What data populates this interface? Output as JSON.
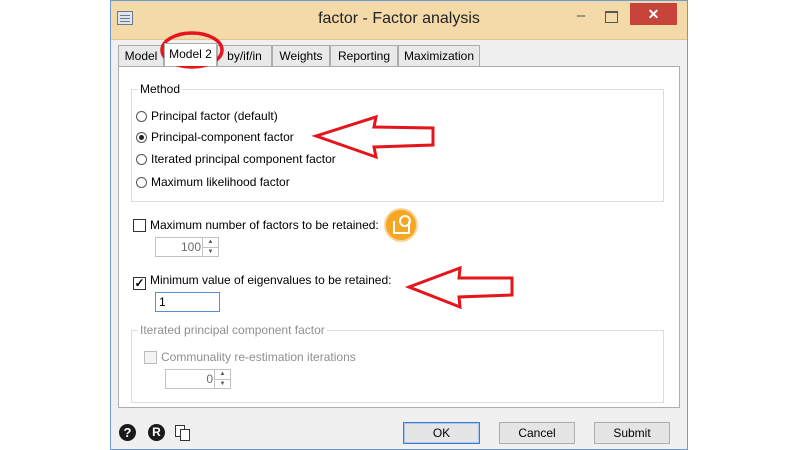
{
  "window": {
    "title": "factor - Factor analysis",
    "min_glyph": "–",
    "close_glyph": "✕"
  },
  "tabs": [
    {
      "label": "Model"
    },
    {
      "label": "Model 2"
    },
    {
      "label": "by/if/in"
    },
    {
      "label": "Weights"
    },
    {
      "label": "Reporting"
    },
    {
      "label": "Maximization"
    }
  ],
  "method": {
    "legend": "Method",
    "options": [
      {
        "label": "Principal factor (default)",
        "selected": false
      },
      {
        "label": "Principal-component factor",
        "selected": true
      },
      {
        "label": "Iterated principal component factor",
        "selected": false
      },
      {
        "label": "Maximum likelihood factor",
        "selected": false
      }
    ]
  },
  "max_factors": {
    "label": "Maximum number of factors to be retained:",
    "checked": false,
    "value": "100"
  },
  "min_eigen": {
    "label": "Minimum value of eigenvalues to be retained:",
    "checked": true,
    "check_glyph": "✓",
    "value": "1"
  },
  "iterated": {
    "legend": "Iterated principal component factor",
    "checkbox_label": "Communality re-estimation iterations",
    "checked": false,
    "value": "0"
  },
  "bottom": {
    "help_glyph": "?",
    "r_glyph": "R",
    "ok_label": "OK",
    "cancel_label": "Cancel",
    "submit_label": "Submit"
  },
  "annotation_color": "#e4151b",
  "badge_color": "#f5a623"
}
